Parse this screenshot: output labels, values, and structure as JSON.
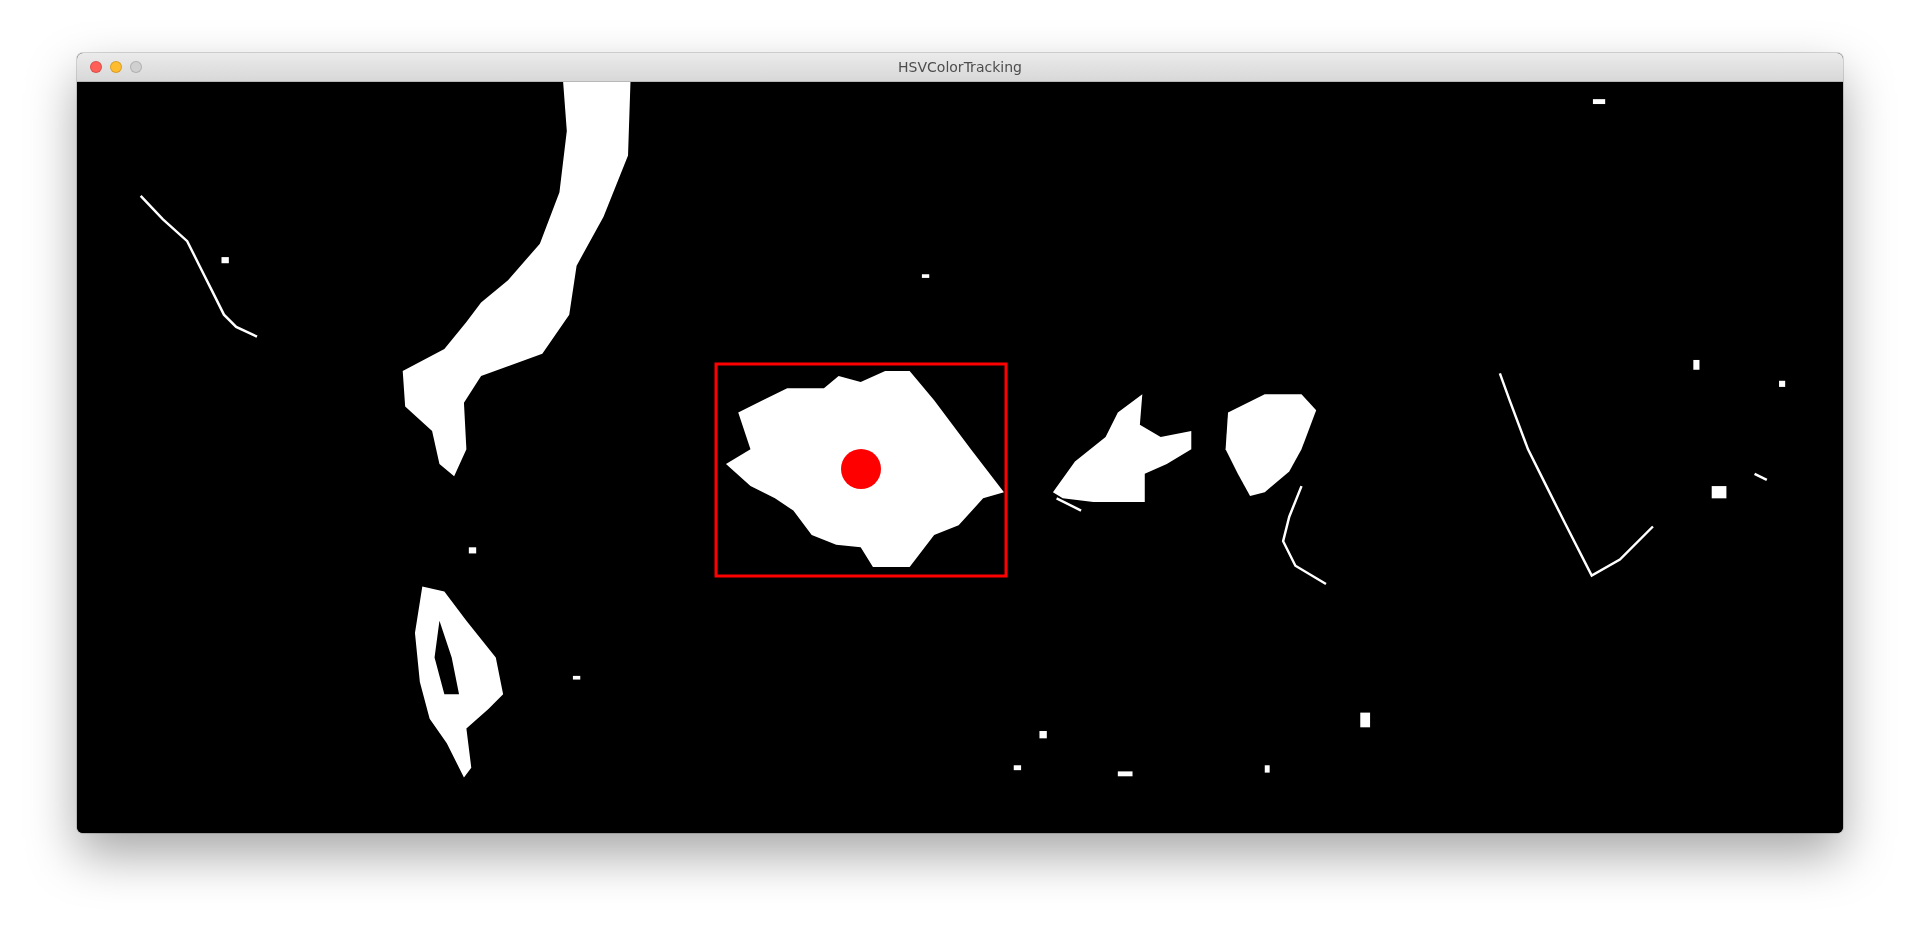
{
  "window": {
    "title": "HSVColorTracking"
  }
}
